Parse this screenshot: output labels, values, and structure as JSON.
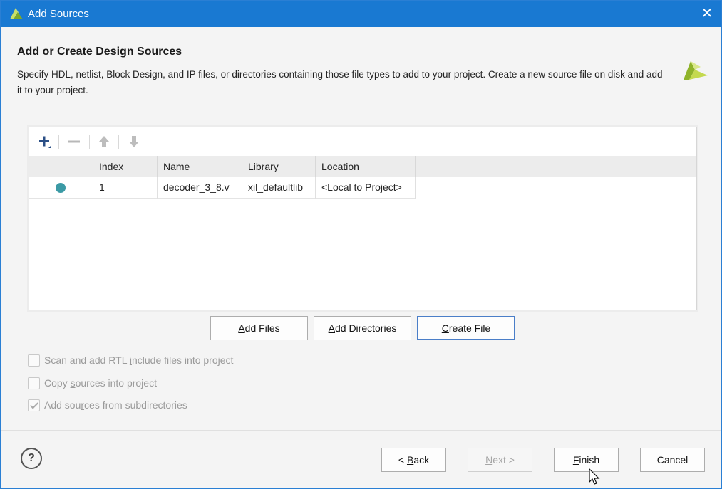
{
  "window": {
    "title": "Add Sources",
    "close_glyph": "✕"
  },
  "header": {
    "heading": "Add or Create Design Sources",
    "description": "Specify HDL, netlist, Block Design, and IP files, or directories containing those file types to add to your project. Create a new source file on disk and add it to your project."
  },
  "toolbar": {
    "items": [
      "plus-icon",
      "minus-icon",
      "arrow-up-icon",
      "arrow-down-icon"
    ]
  },
  "table": {
    "columns": [
      "",
      "Index",
      "Name",
      "Library",
      "Location"
    ],
    "rows": [
      {
        "status": "●",
        "index": "1",
        "name": "decoder_3_8.v",
        "library": "xil_defaultlib",
        "location": "<Local to Project>"
      }
    ]
  },
  "file_buttons": {
    "add_files": {
      "underline": "A",
      "rest": "dd Files"
    },
    "add_directories": {
      "underline": "A",
      "rest": "dd Directories"
    },
    "create_file": {
      "underline": "C",
      "rest": "reate File"
    }
  },
  "options": [
    {
      "pre": "Scan and add RTL ",
      "underline": "i",
      "post": "nclude files into project",
      "checked": false
    },
    {
      "pre": "Copy ",
      "underline": "s",
      "post": "ources into project",
      "checked": false
    },
    {
      "pre": "Add sou",
      "underline": "r",
      "post": "ces from subdirectories",
      "checked": true
    }
  ],
  "footer": {
    "help": "?",
    "back": {
      "pre": "< ",
      "underline": "B",
      "post": "ack"
    },
    "next": {
      "pre": "",
      "underline": "N",
      "post": "ext >"
    },
    "finish": {
      "pre": "",
      "underline": "F",
      "post": "inish"
    },
    "cancel": "Cancel"
  },
  "colors": {
    "titlebar": "#1979d2",
    "status_dot": "#3b9aa5",
    "logo": "#8fb32a"
  }
}
